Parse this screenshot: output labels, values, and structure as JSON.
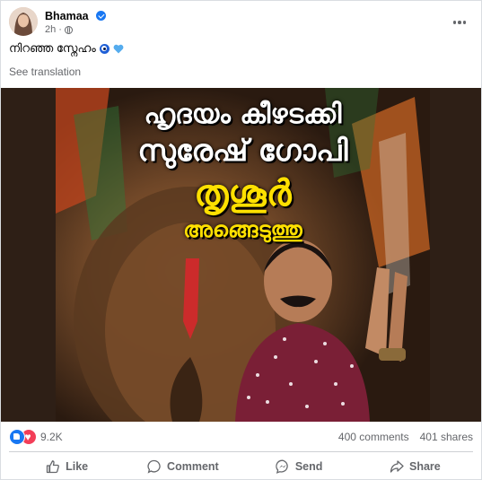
{
  "post": {
    "author": "Bhamaa",
    "time": "2h",
    "caption": "നിറഞ്ഞ സ്നേഹം",
    "see_translation": "See translation"
  },
  "image": {
    "line1": "ഹൃദയം കീഴടക്കി",
    "line2": "സുരേഷ് ഗോപി",
    "line3": "തൃശൂർ",
    "line4": "അങ്ങെടുത്തു"
  },
  "stats": {
    "reactions": "9.2K",
    "comments": "400 comments",
    "shares": "401 shares"
  },
  "actions": {
    "like": "Like",
    "comment": "Comment",
    "send": "Send",
    "share": "Share"
  },
  "colors": {
    "accent": "#1877f2",
    "love": "#f33e58",
    "muted_text": "#65676b"
  }
}
